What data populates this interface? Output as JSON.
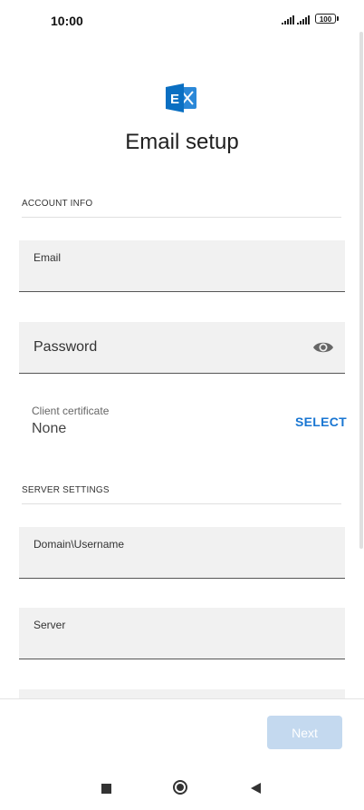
{
  "status_bar": {
    "time": "10:00",
    "battery": "100"
  },
  "header": {
    "title": "Email setup",
    "logo_icon": "exchange-logo-icon"
  },
  "account_info": {
    "section_label": "ACCOUNT INFO",
    "email_label": "Email",
    "password_label": "Password",
    "client_certificate_label": "Client certificate",
    "client_certificate_value": "None",
    "select_label": "SELECT"
  },
  "server_settings": {
    "section_label": "SERVER SETTINGS",
    "domain_username_label": "Domain\\Username",
    "server_label": "Server"
  },
  "footer": {
    "next_label": "Next"
  },
  "colors": {
    "accent": "#1976d2",
    "next_disabled": "#c4d9ef",
    "field_bg": "#f1f1f1",
    "exchange_blue": "#0a6fc2"
  }
}
